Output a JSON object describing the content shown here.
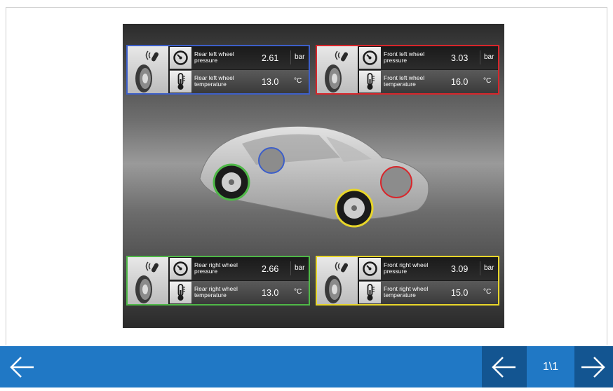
{
  "wheels": {
    "rear_left": {
      "pressure_label": "Rear left wheel\npressure",
      "pressure_value": "2.61",
      "pressure_unit": "bar",
      "temp_label": "Rear left wheel\ntemperature",
      "temp_value": "13.0",
      "temp_unit": "°C",
      "color": "#3d5fc9"
    },
    "front_left": {
      "pressure_label": "Front left wheel\npressure",
      "pressure_value": "3.03",
      "pressure_unit": "bar",
      "temp_label": "Front left wheel\ntemperature",
      "temp_value": "16.0",
      "temp_unit": "°C",
      "color": "#d8262b"
    },
    "rear_right": {
      "pressure_label": "Rear right wheel\npressure",
      "pressure_value": "2.66",
      "pressure_unit": "bar",
      "temp_label": "Rear right wheel\ntemperature",
      "temp_value": "13.0",
      "temp_unit": "°C",
      "color": "#4fb848"
    },
    "front_right": {
      "pressure_label": "Front right wheel\npressure",
      "pressure_value": "3.09",
      "pressure_unit": "bar",
      "temp_label": "Front right wheel\ntemperature",
      "temp_value": "15.0",
      "temp_unit": "°C",
      "color": "#e8d62a"
    }
  },
  "pager": {
    "count": "1\\1"
  },
  "icons": {
    "back": "arrow-left-icon",
    "prev": "arrow-left-icon",
    "next": "arrow-right-icon",
    "tire_sensor": "tire-sensor-icon",
    "pressure": "pressure-gauge-icon",
    "temperature": "thermometer-icon"
  }
}
